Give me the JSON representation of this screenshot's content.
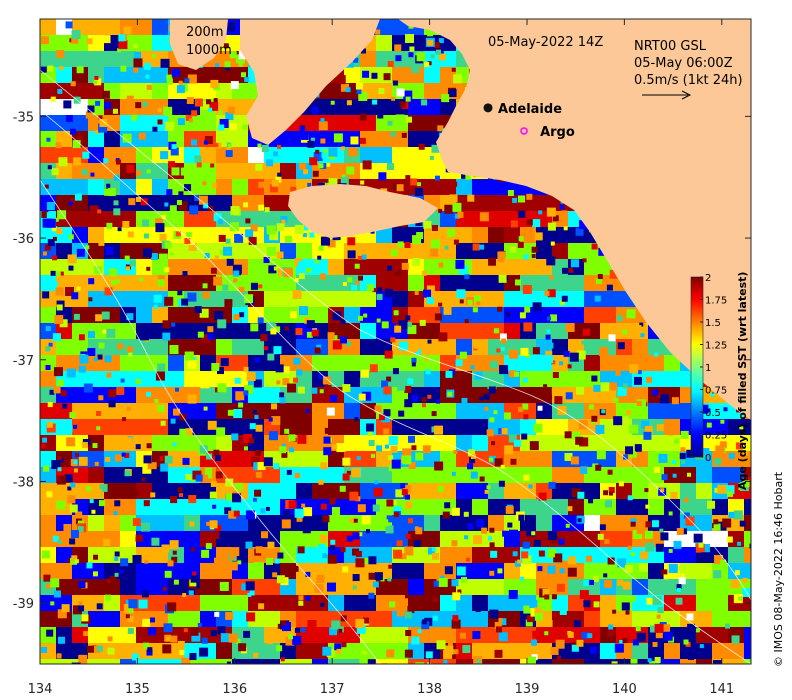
{
  "map": {
    "date_title": "05-May-2022 14Z",
    "product": "NRT00 GSL",
    "current_time": "05-May 06:00Z",
    "current_scale": "0.5m/s (1kt 24h)",
    "contour_labels": [
      "200m",
      "1000m"
    ],
    "credit": "© IMOS 08-May-2022 16:46 Hobart",
    "lon_ticks": [
      "134",
      "135",
      "136",
      "137",
      "138",
      "139",
      "140",
      "141"
    ],
    "lat_ticks": [
      "-35",
      "-36",
      "-37",
      "-38",
      "-39"
    ],
    "lon_range": [
      134,
      141.3
    ],
    "lat_range": [
      -39.5,
      -34.2
    ],
    "places": [
      {
        "name": "Adelaide",
        "lon": 138.6,
        "lat": -34.93,
        "marker": "filled-dot"
      },
      {
        "name": "Argo",
        "lon": 138.97,
        "lat": -35.12,
        "marker": "magenta-ring"
      }
    ],
    "land_color": "#fcc898"
  },
  "colorbar": {
    "title": "Age (days) of filled SST (wrt latest)",
    "tick_labels": [
      "0",
      "0.25",
      "0.5",
      "0.75",
      "1",
      "1.25",
      "1.5",
      "1.75",
      "2"
    ],
    "range": [
      0,
      2
    ],
    "colormap": "jet"
  }
}
